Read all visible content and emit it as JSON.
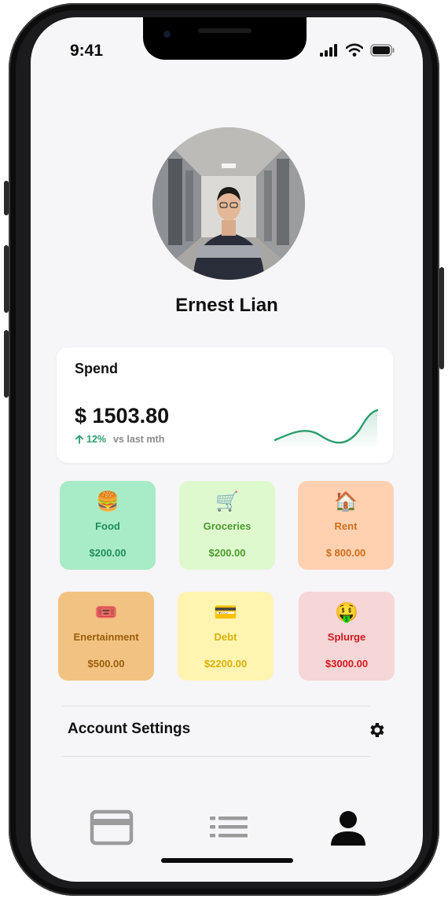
{
  "status_bar": {
    "time": "9:41",
    "signal_icon": "cellular-signal-icon",
    "wifi_icon": "wifi-icon",
    "battery_icon": "battery-icon"
  },
  "profile": {
    "name": "Ernest Lian",
    "avatar_icon": "profile-photo"
  },
  "spend": {
    "title": "Spend",
    "amount": "$ 1503.80",
    "change": "12%",
    "change_direction": "up",
    "comparison": "vs last mth",
    "accent_color": "#2a9d6b"
  },
  "categories": [
    {
      "icon": "🍔",
      "label": "Food",
      "amount": "$200.00",
      "bg": "#a8ebc7",
      "color": "#1f8f5a"
    },
    {
      "icon": "🛒",
      "label": "Groceries",
      "amount": "$200.00",
      "bg": "#dff9cf",
      "color": "#4a9a2c"
    },
    {
      "icon": "🏠",
      "label": "Rent",
      "amount": "$ 800.00",
      "bg": "#ffd1b1",
      "color": "#cc6f1c"
    },
    {
      "icon": "🎟️",
      "label": "Enertainment",
      "amount": "$500.00",
      "bg": "#f2c282",
      "color": "#9a5d0c"
    },
    {
      "icon": "💳",
      "label": "Debt",
      "amount": "$2200.00",
      "bg": "#fff4b0",
      "color": "#d8b10a"
    },
    {
      "icon": "🤑",
      "label": "Splurge",
      "amount": "$3000.00",
      "bg": "#f6d6d6",
      "color": "#d3171e"
    }
  ],
  "settings": {
    "label": "Account Settings",
    "icon": "gear-icon"
  },
  "tab_bar": [
    {
      "name": "cards",
      "icon": "credit-card-icon",
      "active": false
    },
    {
      "name": "list",
      "icon": "list-icon",
      "active": false
    },
    {
      "name": "profile",
      "icon": "person-icon",
      "active": true
    }
  ]
}
